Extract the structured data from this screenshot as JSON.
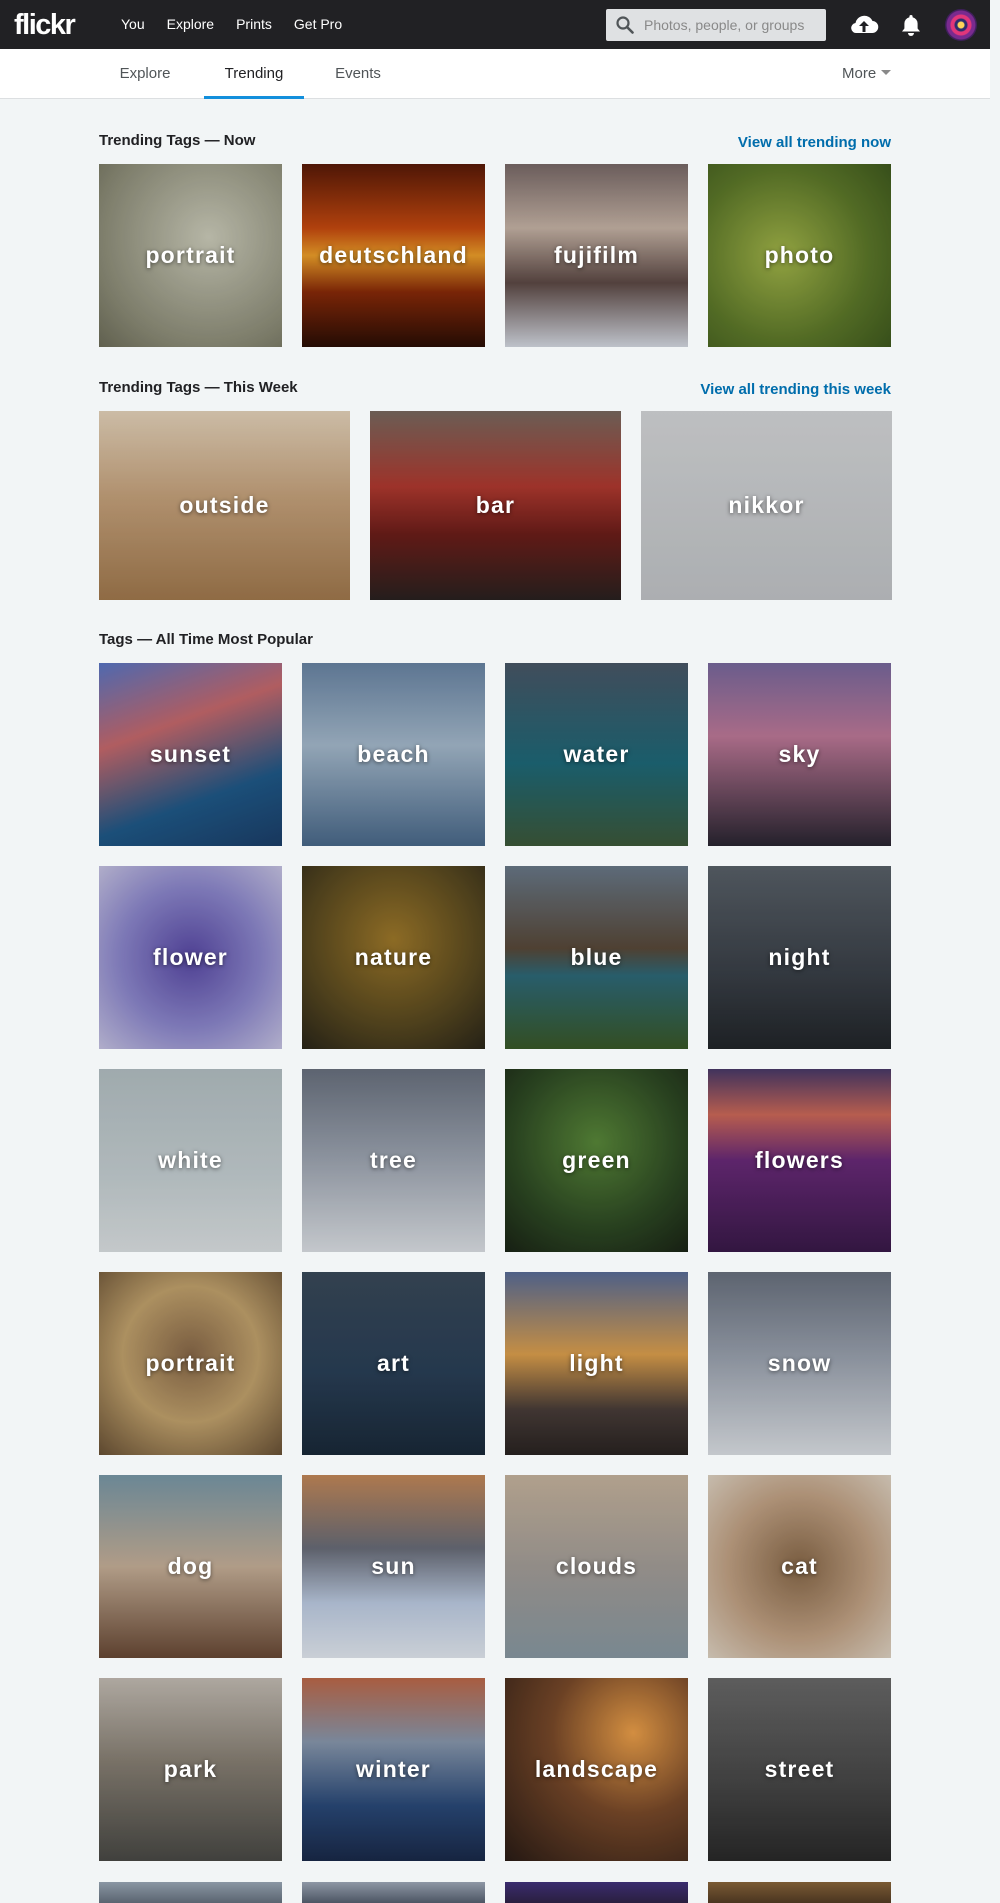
{
  "header": {
    "logo": "flickr",
    "nav": [
      "You",
      "Explore",
      "Prints",
      "Get Pro"
    ],
    "search_placeholder": "Photos, people, or groups"
  },
  "subnav": {
    "tabs": [
      "Explore",
      "Trending",
      "Events"
    ],
    "active_tab": "Trending",
    "more": "More"
  },
  "sections": {
    "now": {
      "title": "Trending Tags — Now",
      "view_all": "View all trending now",
      "tags": [
        "portrait",
        "deutschland",
        "fujifilm",
        "photo"
      ]
    },
    "week": {
      "title": "Trending Tags — This Week",
      "view_all": "View all trending this week",
      "tags": [
        "outside",
        "bar",
        "nikkor"
      ]
    },
    "popular": {
      "title": "Tags — All Time Most Popular",
      "tags": [
        "sunset",
        "beach",
        "water",
        "sky",
        "flower",
        "nature",
        "blue",
        "night",
        "white",
        "tree",
        "green",
        "flowers",
        "portrait",
        "art",
        "light",
        "snow",
        "dog",
        "sun",
        "clouds",
        "cat",
        "park",
        "winter",
        "landscape",
        "street"
      ]
    }
  },
  "colors": {
    "topbar": "#212124",
    "accent_underline": "#128fdc",
    "link": "#006dac",
    "page_bg": "#f2f5f6"
  },
  "icons": {
    "search": "search-icon",
    "upload": "cloud-upload-icon",
    "notifications": "bell-icon",
    "avatar": "avatar"
  }
}
